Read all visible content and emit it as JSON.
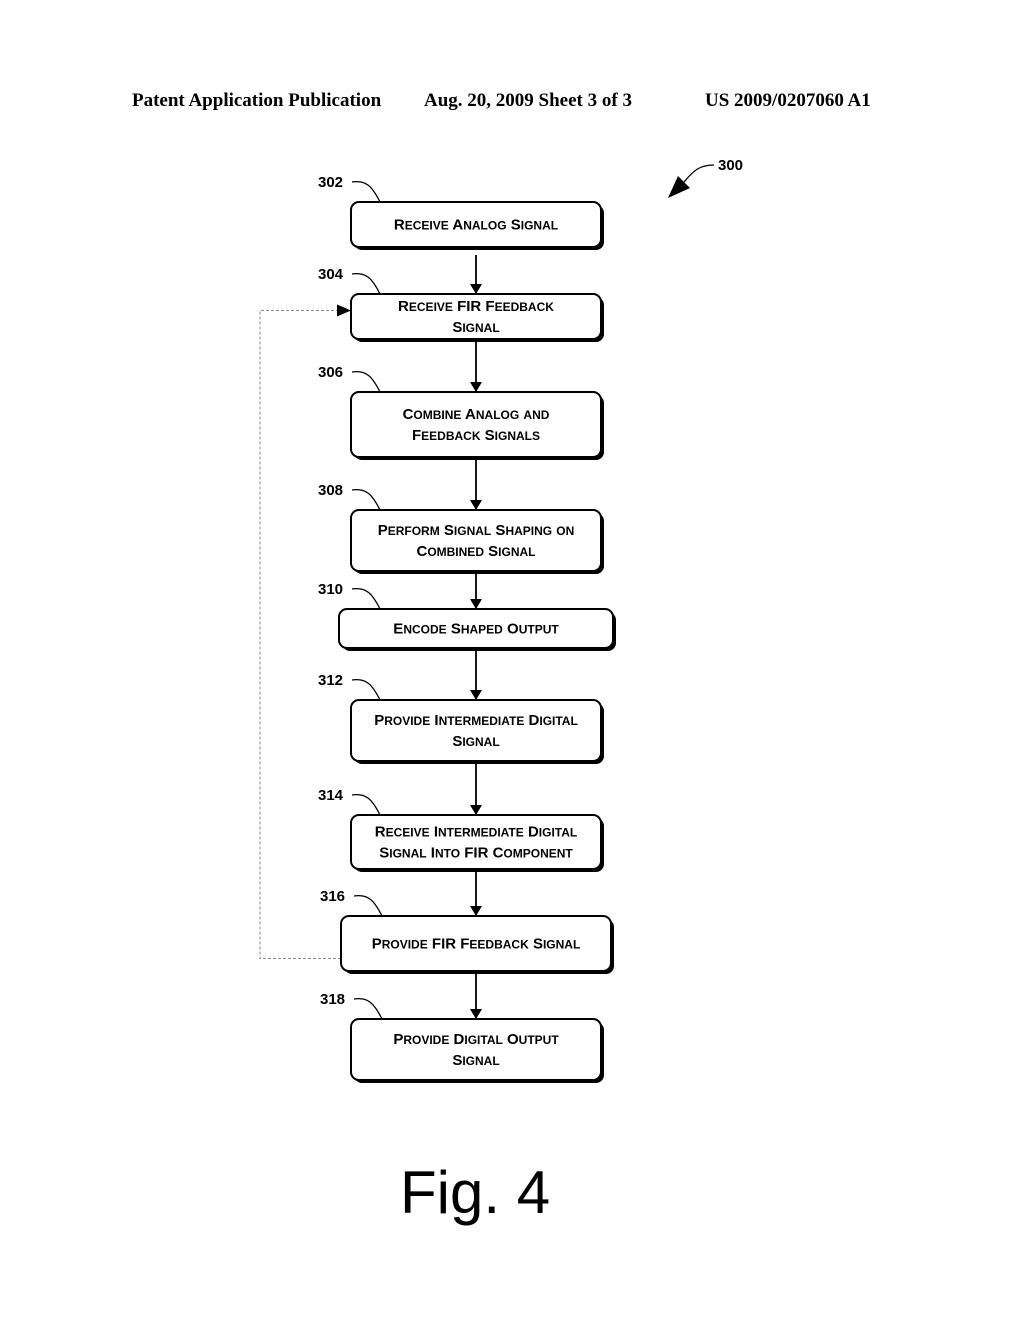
{
  "header": {
    "left": "Patent Application Publication",
    "middle": "Aug. 20, 2009  Sheet 3 of 3",
    "right": "US 2009/0207060 A1"
  },
  "figure": {
    "label": "Fig. 4",
    "ref": "300",
    "steps": [
      {
        "ref": "302",
        "lines": [
          "Receive Analog Signal"
        ]
      },
      {
        "ref": "304",
        "lines": [
          "Receive FIR Feedback",
          "Signal"
        ]
      },
      {
        "ref": "306",
        "lines": [
          "Combine Analog and",
          "Feedback Signals"
        ]
      },
      {
        "ref": "308",
        "lines": [
          "Perform Signal Shaping on",
          "Combined Signal"
        ]
      },
      {
        "ref": "310",
        "lines": [
          "Encode Shaped Output"
        ]
      },
      {
        "ref": "312",
        "lines": [
          "Provide Intermediate Digital",
          "Signal"
        ]
      },
      {
        "ref": "314",
        "lines": [
          "Receive Intermediate Digital",
          "Signal Into FIR Component"
        ]
      },
      {
        "ref": "316",
        "lines": [
          "Provide FIR Feedback Signal"
        ]
      },
      {
        "ref": "318",
        "lines": [
          "Provide Digital Output",
          "Signal"
        ]
      }
    ],
    "feedback": {
      "from": "316",
      "to": "304",
      "style": "dashed"
    }
  }
}
